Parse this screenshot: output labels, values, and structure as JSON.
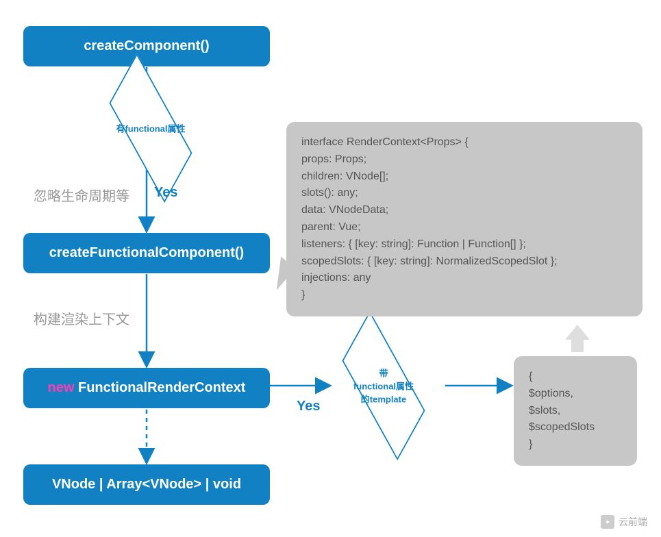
{
  "nodes": {
    "start": "createComponent()",
    "decision1": "有functional属性",
    "step2": "createFunctionalComponent()",
    "step3_kw": "new",
    "step3_rest": " FunctionalRenderContext",
    "decision2_line1": "带",
    "decision2_line2": "functional属性",
    "decision2_line3": "的template",
    "end": "VNode | Array<VNode> | void"
  },
  "labels": {
    "ignore_lifecycle": "忽略生命周期等",
    "yes1": "Yes",
    "build_context": "构建渲染上下文",
    "yes2": "Yes"
  },
  "code": {
    "interface": [
      "interface RenderContext<Props> {",
      "  props: Props;",
      "  children: VNode[];",
      "  slots(): any;",
      "  data: VNodeData;",
      "  parent: Vue;",
      "  listeners: { [key: string]: Function | Function[] };",
      "  scopedSlots: { [key: string]: NormalizedScopedSlot };",
      "  injections: any",
      "}"
    ],
    "extras": [
      "{",
      "  $options,",
      "  $slots,",
      "  $scopedSlots",
      "}"
    ]
  },
  "watermark": {
    "icon": "wechat-icon",
    "text": "云前端"
  },
  "colors": {
    "primary": "#1281c4",
    "grey": "#c7c7c7"
  }
}
